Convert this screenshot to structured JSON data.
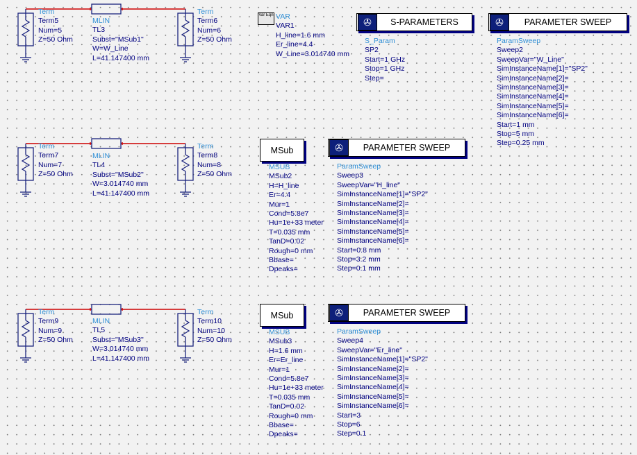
{
  "row1": {
    "term_left": {
      "lines": [
        "Term",
        "Term5",
        "Num=5",
        "Z=50 Ohm"
      ]
    },
    "mlin": {
      "lines": [
        "MLIN",
        "TL3",
        "Subst=\"MSub1\"",
        "W=W_Line",
        "L=41.147400 mm"
      ]
    },
    "term_right": {
      "lines": [
        "Term",
        "Term6",
        "Num=6",
        "Z=50 Ohm"
      ]
    }
  },
  "row2": {
    "term_left": {
      "lines": [
        "Term",
        "Term7",
        "Num=7",
        "Z=50 Ohm"
      ]
    },
    "mlin": {
      "lines": [
        "MLIN",
        "TL4",
        "Subst=\"MSub2\"",
        "W=3.014740 mm",
        "L=41.147400 mm"
      ]
    },
    "term_right": {
      "lines": [
        "Term",
        "Term8",
        "Num=8",
        "Z=50 Ohm"
      ]
    },
    "msub_label": "MSub",
    "msub": {
      "lines": [
        "MSUB",
        "MSub2",
        "H=H_line",
        "Er=4.4",
        "Mur=1",
        "Cond=5.8e7",
        "Hu=1e+33 meter",
        "T=0.035 mm",
        "TanD=0.02",
        "Rough=0 mm",
        "Bbase=",
        "Dpeaks="
      ]
    },
    "sweep_label": "PARAMETER SWEEP",
    "sweep": {
      "lines": [
        "ParamSweep",
        "Sweep3",
        "SweepVar=\"H_line\"",
        "SimInstanceName[1]=\"SP2\"",
        "SimInstanceName[2]=",
        "SimInstanceName[3]=",
        "SimInstanceName[4]=",
        "SimInstanceName[5]=",
        "SimInstanceName[6]=",
        "Start=0.8 mm",
        "Stop=3.2 mm",
        "Step=0.1 mm"
      ]
    }
  },
  "row3": {
    "term_left": {
      "lines": [
        "Term",
        "Term9",
        "Num=9",
        "Z=50 Ohm"
      ]
    },
    "mlin": {
      "lines": [
        "MLIN",
        "TL5",
        "Subst=\"MSub3\"",
        "W=3.014740 mm",
        "L=41.147400 mm"
      ]
    },
    "term_right": {
      "lines": [
        "Term",
        "Term10",
        "Num=10",
        "Z=50 Ohm"
      ]
    },
    "msub_label": "MSub",
    "msub": {
      "lines": [
        "MSUB",
        "MSub3",
        "H=1.6 mm",
        "Er=Er_line",
        "Mur=1",
        "Cond=5.8e7",
        "Hu=1e+33 meter",
        "T=0.035 mm",
        "TanD=0.02",
        "Rough=0 mm",
        "Bbase=",
        "Dpeaks="
      ]
    },
    "sweep_label": "PARAMETER SWEEP",
    "sweep": {
      "lines": [
        "ParamSweep",
        "Sweep4",
        "SweepVar=\"Er_line\"",
        "SimInstanceName[1]=\"SP2\"",
        "SimInstanceName[2]=",
        "SimInstanceName[3]=",
        "SimInstanceName[4]=",
        "SimInstanceName[5]=",
        "SimInstanceName[6]=",
        "Start=3",
        "Stop=6",
        "Step=0.1"
      ]
    }
  },
  "var_block": {
    "icon_text": "Var Eqn",
    "lines": [
      "VAR",
      "VAR1",
      "H_line=1.6 mm",
      "Er_line=4.4",
      "W_Line=3.014740 mm"
    ]
  },
  "sparams": {
    "label": "S-PARAMETERS",
    "lines": [
      "S_Param",
      "SP2",
      "Start=1 GHz",
      "Stop=1 GHz",
      "Step="
    ]
  },
  "sweep_top": {
    "label": "PARAMETER SWEEP",
    "lines": [
      "ParamSweep",
      "Sweep2",
      "SweepVar=\"W_Line\"",
      "SimInstanceName[1]=\"SP2\"",
      "SimInstanceName[2]=",
      "SimInstanceName[3]=",
      "SimInstanceName[4]=",
      "SimInstanceName[5]=",
      "SimInstanceName[6]=",
      "Start=1 mm",
      "Stop=5 mm",
      "Step=0.25 mm"
    ]
  },
  "colors": {
    "wire": "#1a237e",
    "port_wire": "#cc0000",
    "label": "#000080",
    "label_header": "#2f8fd6",
    "block_shadow": "#000080",
    "grid_dot": "#7a7a7a"
  },
  "icons": {
    "sim_block": "sim-controller-icon",
    "var_block": "var-eqn-icon",
    "term": "term-resistor-icon",
    "ground": "ground-icon"
  }
}
